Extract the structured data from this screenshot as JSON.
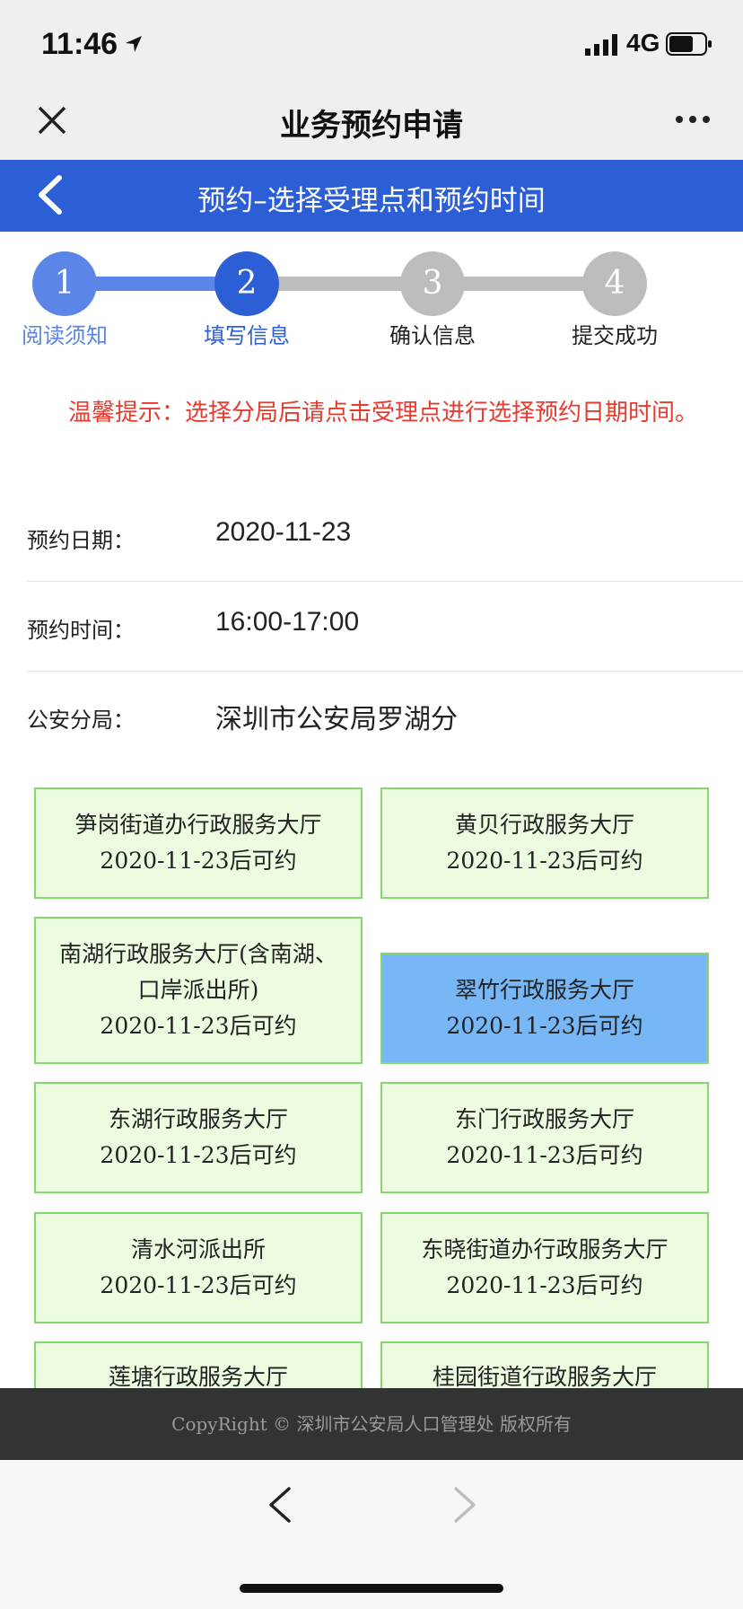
{
  "status": {
    "time": "11:46",
    "network": "4G"
  },
  "wechat": {
    "title": "业务预约申请"
  },
  "header": {
    "title": "预约–选择受理点和预约时间"
  },
  "steps": [
    {
      "num": "1",
      "label": "阅读须知"
    },
    {
      "num": "2",
      "label": "填写信息"
    },
    {
      "num": "3",
      "label": "确认信息"
    },
    {
      "num": "4",
      "label": "提交成功"
    }
  ],
  "tip": "温馨提示：选择分局后请点击受理点进行选择预约日期时间。",
  "form": {
    "date_label": "预约日期：",
    "date_value": "2020-11-23",
    "time_label": "预约时间：",
    "time_value": "16:00-17:00",
    "bureau_label": "公安分局：",
    "bureau_value": "深圳市公安局罗湖分"
  },
  "halls": [
    {
      "name": "笋岗街道办行政服务大厅",
      "avail": "2020-11-23后可约"
    },
    {
      "name": "黄贝行政服务大厅",
      "avail": "2020-11-23后可约"
    },
    {
      "name": "南湖行政服务大厅(含南湖、口岸派出所)",
      "avail": "2020-11-23后可约"
    },
    {
      "name": "翠竹行政服务大厅",
      "avail": "2020-11-23后可约",
      "selected": true
    },
    {
      "name": "东湖行政服务大厅",
      "avail": "2020-11-23后可约"
    },
    {
      "name": "东门行政服务大厅",
      "avail": "2020-11-23后可约"
    },
    {
      "name": "清水河派出所",
      "avail": "2020-11-23后可约"
    },
    {
      "name": "东晓街道办行政服务大厅",
      "avail": "2020-11-23后可约"
    },
    {
      "name": "莲塘行政服务大厅",
      "avail": ""
    },
    {
      "name": "桂园街道行政服务大厅",
      "avail": ""
    }
  ],
  "footer": "CopyRight © 深圳市公安局人口管理处 版权所有",
  "icons": {
    "location": "location-arrow-icon",
    "signal": "signal-bars-icon",
    "battery": "battery-icon",
    "close": "close-icon",
    "more": "more-dots-icon",
    "back": "back-chevron-icon",
    "nav_back": "nav-back-icon",
    "nav_forward": "nav-forward-icon"
  }
}
